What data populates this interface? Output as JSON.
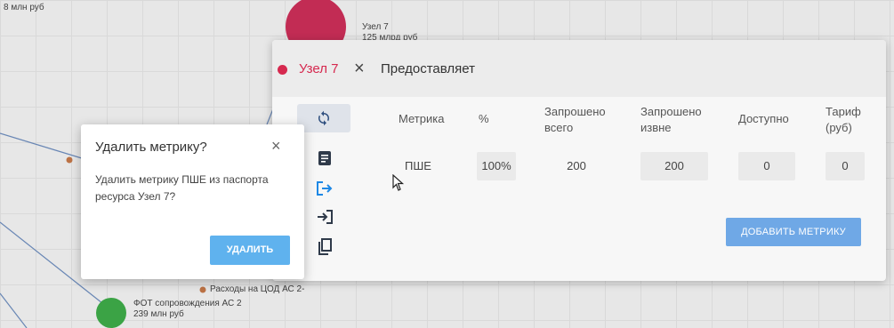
{
  "graph": {
    "top_left_label": "8 млн руб",
    "node7_name": "Узел 7",
    "node7_value": "125 млрд руб",
    "expense_label": "Расходы на ЦОД АС 2-",
    "green_node_name": "ФОТ сопровождения АС 2",
    "green_node_value": "239 млн руб",
    "colors": {
      "node7": "#cf2f5a",
      "green_node": "#3fae4a",
      "orange_dot": "#c87a4a",
      "edge": "#6f8fc0"
    }
  },
  "panel": {
    "node_name": "Узел 7",
    "close_icon": "×",
    "title": "Предоставляет",
    "tools": [
      "refresh-icon",
      "document-icon",
      "export-icon",
      "import-icon",
      "copy-icon"
    ],
    "table": {
      "headers": {
        "metric": "Метрика",
        "percent": "%",
        "requested_total": [
          "Запрошено",
          "всего"
        ],
        "requested_external": [
          "Запрошено",
          "извне"
        ],
        "available": "Доступно",
        "tariff": [
          "Тариф",
          "(руб)"
        ]
      },
      "rows": [
        {
          "metric": "ПШЕ",
          "percent": "100%",
          "requested_total": "200",
          "requested_external": "200",
          "available": "0",
          "tariff": "0"
        }
      ]
    },
    "add_metric_label": "ДОБАВИТЬ МЕТРИКУ",
    "accent_color": "#d6294f"
  },
  "dialog": {
    "title": "Удалить метрику?",
    "close_icon": "×",
    "message": "Удалить метрику ПШЕ из паспорта ресурса Узел 7?",
    "delete_label": "УДАЛИТЬ",
    "button_color": "#5fb2ee"
  }
}
